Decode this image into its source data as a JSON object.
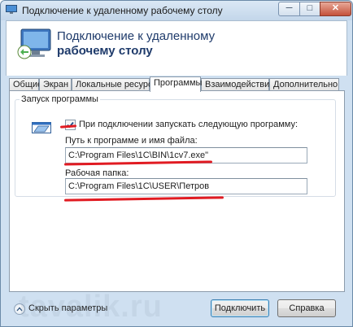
{
  "window": {
    "title": "Подключение к удаленному рабочему столу",
    "min_label": "─",
    "max_label": "□",
    "close_label": "✕"
  },
  "header": {
    "title_line1": "Подключение к удаленному",
    "title_line2": "рабочему столу"
  },
  "tabs": [
    {
      "label": "Общие"
    },
    {
      "label": "Экран"
    },
    {
      "label": "Локальные ресурсы"
    },
    {
      "label": "Программы",
      "active": true
    },
    {
      "label": "Взаимодействие"
    },
    {
      "label": "Дополнительно"
    }
  ],
  "program": {
    "group_title": "Запуск программы",
    "start_checkbox_label": "При подключении запускать следующую программу:",
    "start_checked": true,
    "path_label": "Путь к программе и имя файла:",
    "path_value": "C:\\Program Files\\1C\\BIN\\1cv7.exe\"",
    "workdir_label": "Рабочая папка:",
    "workdir_value": "C:\\Program Files\\1C\\USER\\Петров"
  },
  "footer": {
    "options_label": "Скрыть параметры",
    "connect_label": "Подключить",
    "help_label": "Справка"
  },
  "watermark": "tavalik.ru",
  "colors": {
    "highlight_red": "#e11b22",
    "title_blue": "#1f3b6b"
  }
}
